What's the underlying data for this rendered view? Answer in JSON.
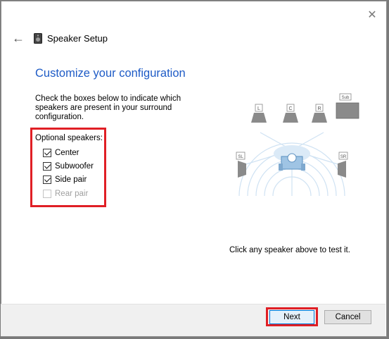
{
  "window": {
    "title": "Speaker Setup",
    "close_glyph": "✕",
    "back_glyph": "←"
  },
  "page": {
    "heading": "Customize your configuration",
    "instructions": "Check the boxes below to indicate which speakers are present in your surround configuration."
  },
  "options": {
    "title": "Optional speakers:",
    "items": [
      {
        "label": "Center",
        "checked": true,
        "disabled": false
      },
      {
        "label": "Subwoofer",
        "checked": true,
        "disabled": false
      },
      {
        "label": "Side pair",
        "checked": true,
        "disabled": false
      },
      {
        "label": "Rear pair",
        "checked": false,
        "disabled": true
      }
    ]
  },
  "diagram": {
    "speaker_labels": {
      "left": "L",
      "center": "C",
      "right": "R",
      "sub": "Sub",
      "side_left": "SL",
      "side_right": "SR"
    },
    "speaker_color": "#8a8a8a",
    "wave_color": "#cfe2f3",
    "listener_color": "#9fc4e4"
  },
  "hint": "Click any speaker above to test it.",
  "buttons": {
    "next": "Next",
    "cancel": "Cancel"
  },
  "colors": {
    "heading": "#1e5bc6",
    "highlight": "#e01f25"
  }
}
